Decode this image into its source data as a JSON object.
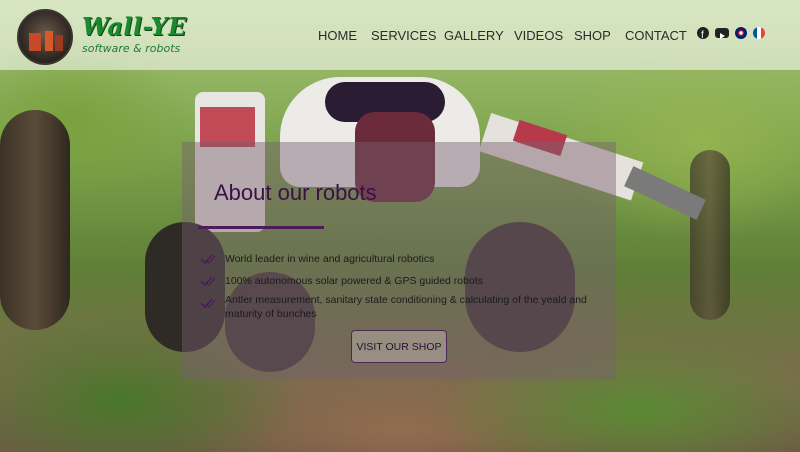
{
  "brand": {
    "title": "Wall-YE",
    "subtitle": "software & robots"
  },
  "nav": {
    "items": [
      "HOME",
      "SERVICES",
      "GALLERY",
      "VIDEOS",
      "SHOP",
      "CONTACT"
    ],
    "social_icons": [
      "facebook-icon",
      "youtube-icon"
    ],
    "language_icons": [
      "uk-flag-icon",
      "france-flag-icon"
    ]
  },
  "hero": {
    "title": "About our robots",
    "bullets": [
      "World leader in wine and agricultural robotics",
      "100% autonomous solar powered & GPS guided robots",
      "Antler measurement, sanitary state conditioning & calculating of the yeald and maturity of bunches"
    ],
    "cta_label": "VISIT OUR SHOP"
  },
  "colors": {
    "accent_purple": "#4b1b5a",
    "brand_green": "#1a8a2e"
  }
}
